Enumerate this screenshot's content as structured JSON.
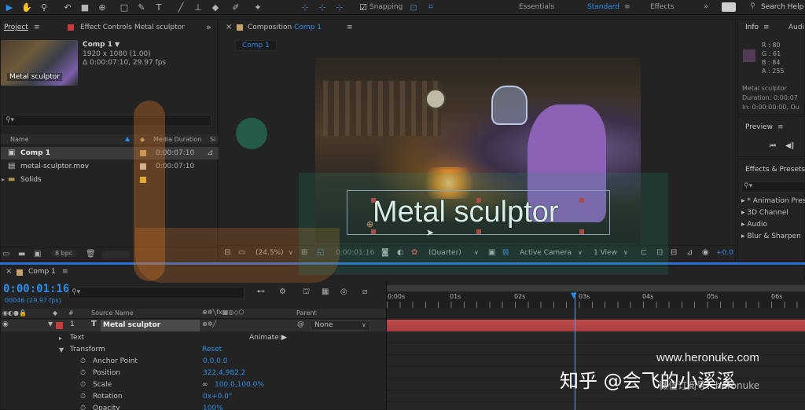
{
  "toolbar": {
    "snapping_label": "Snapping",
    "workspace_essentials": "Essentials",
    "workspace_standard": "Standard",
    "workspace_effects": "Effects",
    "search_placeholder": "Search Help"
  },
  "project_panel": {
    "tab_project": "Project",
    "tab_effect_controls": "Effect Controls Metal sculptor",
    "thumb_caption": "Metal sculptor",
    "comp_name": "Comp 1",
    "comp_res": "1920 x 1080 (1.00)",
    "comp_duration": "Δ 0:00:07:10, 29.97 fps",
    "col_name": "Name",
    "col_media_duration": "Media Duration",
    "col_si": "Si",
    "items": [
      {
        "name": "Comp 1",
        "duration": "0:00:07:10",
        "label_color": "#c8a46a"
      },
      {
        "name": "metal-sculptor.mov",
        "duration": "0:00:07:10",
        "label_color": "#cfcfbd"
      },
      {
        "name": "Solids",
        "duration": "",
        "label_color": "#e0c53a"
      }
    ],
    "bpc": "8 bpc"
  },
  "comp_panel": {
    "tab_title": "Composition",
    "tab_comp": "Comp 1",
    "sub_tab": "Comp 1",
    "overlay_text": "Metal sculptor",
    "zoom": "(24.5%)",
    "timecode": "0:00:01:16",
    "resolution": "(Quarter)",
    "camera": "Active Camera",
    "view": "1 View",
    "exposure": "+0.0"
  },
  "info_panel": {
    "tab_info": "Info",
    "tab_audio": "Audi",
    "r": "R : 80",
    "g": "G : 61",
    "b": "B : 84",
    "a": "A : 255",
    "swatch_color": "#503d54",
    "layer_name": "Metal sculptor",
    "duration": "Duration: 0:00:07",
    "in": "In: 0:00:00:00, Ou"
  },
  "preview_panel": {
    "title": "Preview"
  },
  "effects_panel": {
    "title": "Effects & Presets",
    "items": [
      "* Animation Pres",
      "3D Channel",
      "Audio",
      "Blur & Sharpen"
    ]
  },
  "timeline": {
    "tab": "Comp 1",
    "timecode": "0:00:01:16",
    "frames": "00046 (29.97 fps)",
    "col_source": "Source Name",
    "col_parent": "Parent",
    "layer_number": "1",
    "layer_name": "Metal sculptor",
    "parent_value": "None",
    "text_group": "Text",
    "animate_label": "Animate:",
    "transform_group": "Transform",
    "reset_label": "Reset",
    "properties": [
      {
        "name": "Anchor Point",
        "value": "0.0,0.0"
      },
      {
        "name": "Position",
        "value": "322.4,982.2"
      },
      {
        "name": "Scale",
        "value": "100.0,100.0%"
      },
      {
        "name": "Rotation",
        "value": "0x+0.0°"
      },
      {
        "name": "Opacity",
        "value": "100%"
      }
    ],
    "ruler_labels": [
      "0:00s",
      "01s",
      "02s",
      "03s",
      "04s",
      "05s",
      "06s"
    ],
    "playhead_fraction": 0.205
  },
  "watermark": {
    "site": "www.heronuke.com",
    "zhihu": "知乎 @会飞的小溪溪",
    "wechat": "微信订阅号：heronuke"
  }
}
